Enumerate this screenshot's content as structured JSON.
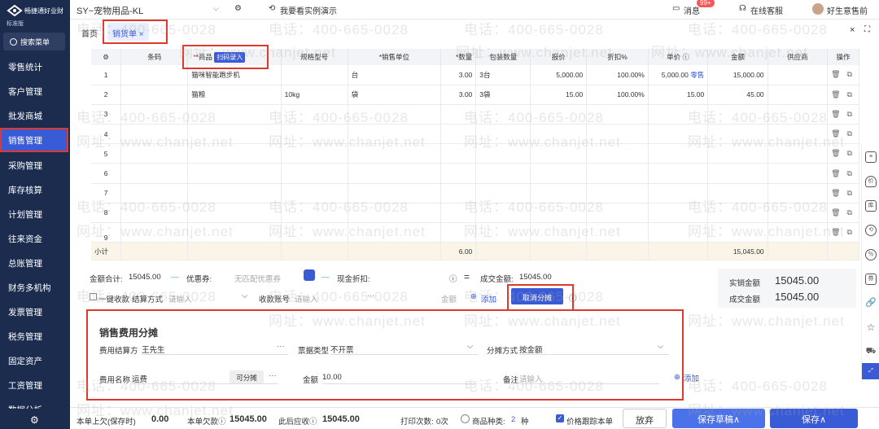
{
  "app": {
    "brand": "畅捷通好业财",
    "edition": "标准版",
    "logo_icon": "chanjet-logo-icon",
    "menu_search": "搜索菜单"
  },
  "sidebar": {
    "items": [
      {
        "label": "零售统计"
      },
      {
        "label": "客户管理"
      },
      {
        "label": "批发商城"
      },
      {
        "label": "销售管理",
        "active": true
      },
      {
        "label": "采购管理"
      },
      {
        "label": "库存核算"
      },
      {
        "label": "计划管理"
      },
      {
        "label": "往来资金"
      },
      {
        "label": "总账管理"
      },
      {
        "label": "财务多机构"
      },
      {
        "label": "发票管理"
      },
      {
        "label": "税务管理"
      },
      {
        "label": "固定资产"
      },
      {
        "label": "工资管理"
      },
      {
        "label": "数据分析"
      }
    ]
  },
  "topbar": {
    "company": "SY~宠物用品-KL",
    "demo": "我要看实例演示",
    "messages": "消息",
    "message_badge": "99+",
    "support": "在线客服",
    "user": "好生意售前"
  },
  "tabs": {
    "home": "首页",
    "sales_order": "销货单 ×"
  },
  "watermark": {
    "phone": "电话：400-665-0028",
    "site": "网址：www.chanjet.net"
  },
  "table": {
    "headers": [
      "条码",
      "*商品",
      "扫码录入",
      "规格型号",
      "*销售单位",
      "*数量",
      "包装数量",
      "报价",
      "折扣%",
      "单价 ⓘ",
      "金额",
      "供应商",
      "操作"
    ],
    "rows": [
      {
        "no": "1",
        "barcode": "",
        "goods": "猫咪智能跑步机",
        "spec": "",
        "unit": "台",
        "qty": "3.00",
        "pack": "3台",
        "quote": "5,000.00",
        "discount": "100.00%",
        "price": "5,000.00",
        "retail": "零售",
        "amount": "15,000.00",
        "supplier": ""
      },
      {
        "no": "2",
        "barcode": "",
        "goods": "猫粮",
        "spec": "10kg",
        "unit": "袋",
        "qty": "3.00",
        "pack": "3袋",
        "quote": "15.00",
        "discount": "100.00%",
        "price": "15.00",
        "retail": "",
        "amount": "45.00",
        "supplier": ""
      },
      {
        "no": "3"
      },
      {
        "no": "4"
      },
      {
        "no": "5"
      },
      {
        "no": "6"
      },
      {
        "no": "7"
      },
      {
        "no": "8"
      },
      {
        "no": "9"
      }
    ],
    "subtotal": {
      "label": "小计",
      "qty": "6.00",
      "amount": "15,045.00"
    }
  },
  "summary": {
    "total_label": "金额合计:",
    "total": "15045.00",
    "coupon_label": "优惠券:",
    "coupon_placeholder": "无匹配优惠券",
    "cash_discount_label": "现金折扣:",
    "deal_label": "成交金额:",
    "deal": "15045.00",
    "one_click": "一键收款",
    "settle_label": "结算方式",
    "settle_ph": "请输入",
    "account_label": "收款账号",
    "account_ph": "请输入",
    "amount_label": "金额",
    "add": "添加",
    "cancel_alloc": "取消分摊",
    "actual_label": "实销金额",
    "actual": "15045.00",
    "deal2_label": "成交金额",
    "deal2": "15045.00"
  },
  "alloc": {
    "title": "销售费用分摊",
    "settle_party_label": "费用结算方",
    "settle_party": "王先生",
    "invoice_type_label": "票据类型",
    "invoice_type": "不开票",
    "method_label": "分摊方式",
    "method": "按金额",
    "fee_name_label": "费用名称",
    "fee_name": "运费",
    "allocable": "可分摊",
    "amount_label": "金额",
    "amount": "10.00",
    "remark_label": "备注",
    "remark_ph": "请输入",
    "add": "添加"
  },
  "footer": {
    "prev_debt_label": "本单上欠(保存时)",
    "prev_debt": "0.00",
    "debt_label": "本单欠款ⓘ",
    "debt": "15045.00",
    "receivable_label": "此后应收ⓘ",
    "receivable": "15045.00",
    "print_label": "打印次数:",
    "print": "0次",
    "kinds_label": "商品种类:",
    "kinds": "2",
    "kinds_unit": "种",
    "price_track": "价格跟踪本单",
    "abandon": "放弃",
    "save_draft": "保存草稿∧",
    "save": "保存∧"
  }
}
